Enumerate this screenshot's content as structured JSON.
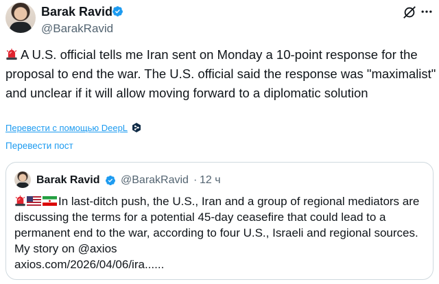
{
  "author": {
    "name": "Barak Ravid",
    "handle": "@BarakRavid"
  },
  "tweet": {
    "text": "A U.S. official tells me Iran sent on Monday a 10-point response for the proposal to end the war. The U.S. official said the response was \"maximalist\" and unclear if it will allow moving forward to a diplomatic solution",
    "translate_deepl_label": "Перевести с помощью DeepL",
    "translate_post_label": "Перевести пост"
  },
  "quoted_tweet": {
    "name": "Barak Ravid",
    "handle": "@BarakRavid",
    "separator": "·",
    "time": "12 ч",
    "lines": [
      "In last-ditch push, the U.S., Iran and a group of regional mediators are",
      "discussing the terms for a potential 45-day ceasefire that could lead to a",
      "permanent end to the war, according to four U.S., Israeli and regional sources.",
      "My story on @axios",
      "axios.com/2026/04/06/ira......"
    ]
  },
  "icons": {
    "verified": "verified-badge-icon",
    "grok": "grok-icon",
    "more": "more-icon",
    "siren": "siren-emoji-icon",
    "deepl": "deepl-icon",
    "us_flag": "us-flag-icon",
    "iran_flag": "iran-flag-icon"
  },
  "colors": {
    "link": "#1d9bf0",
    "secondary_text": "#536471",
    "border": "#cfd9de"
  }
}
